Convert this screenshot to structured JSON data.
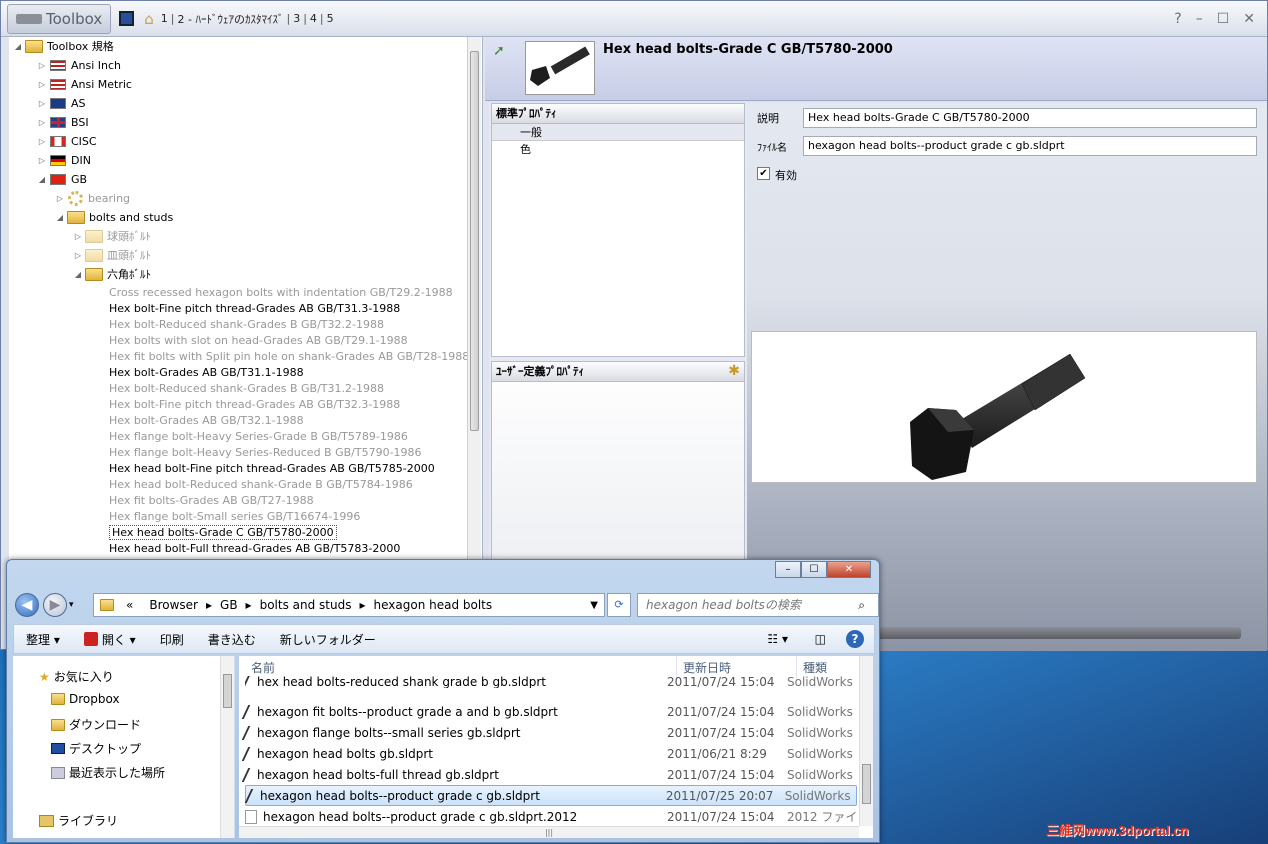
{
  "titlebar": {
    "logo": "Toolbox",
    "tabs": [
      "1",
      "2 - ﾊｰﾄﾞｳｪｱのｶｽﾀﾏｲｽﾞ",
      "3",
      "4",
      "5"
    ],
    "help": "?",
    "minimize": "–",
    "maximize": "☐",
    "close": "✕"
  },
  "tree": {
    "root": "Toolbox 規格",
    "standards": [
      "Ansi Inch",
      "Ansi Metric",
      "AS",
      "BSI",
      "CISC",
      "DIN",
      "GB"
    ],
    "gb_children": [
      "bearing",
      "bolts and studs"
    ],
    "bolt_groups": [
      "球頭ﾎﾞﾙﾄ",
      "皿頭ﾎﾞﾙﾄ",
      "六角ﾎﾞﾙﾄ"
    ],
    "items": [
      {
        "label": "Cross recessed hexagon bolts with indentation GB/T29.2-1988",
        "enabled": false
      },
      {
        "label": "Hex bolt-Fine pitch thread-Grades AB GB/T31.3-1988",
        "enabled": true
      },
      {
        "label": "Hex bolt-Reduced shank-Grades B GB/T32.2-1988",
        "enabled": false
      },
      {
        "label": "Hex bolts with slot on head-Grades AB GB/T29.1-1988",
        "enabled": false
      },
      {
        "label": "Hex fit bolts with Split pin hole on shank-Grades AB GB/T28-1988",
        "enabled": false
      },
      {
        "label": "Hex bolt-Grades AB GB/T31.1-1988",
        "enabled": true
      },
      {
        "label": "Hex bolt-Reduced shank-Grades B GB/T31.2-1988",
        "enabled": false
      },
      {
        "label": "Hex bolt-Fine pitch thread-Grades AB GB/T32.3-1988",
        "enabled": false
      },
      {
        "label": "Hex bolt-Grades AB GB/T32.1-1988",
        "enabled": false
      },
      {
        "label": "Hex flange bolt-Heavy Series-Grade B GB/T5789-1986",
        "enabled": false
      },
      {
        "label": "Hex flange bolt-Heavy Series-Reduced B GB/T5790-1986",
        "enabled": false
      },
      {
        "label": "Hex head bolt-Fine pitch thread-Grades AB GB/T5785-2000",
        "enabled": true
      },
      {
        "label": "Hex head bolt-Reduced shank-Grade B GB/T5784-1986",
        "enabled": false
      },
      {
        "label": "Hex fit bolts-Grades AB GB/T27-1988",
        "enabled": false
      },
      {
        "label": "Hex flange bolt-Small series GB/T16674-1996",
        "enabled": false
      },
      {
        "label": "Hex head bolts-Grade C GB/T5780-2000",
        "enabled": true,
        "selected": true
      },
      {
        "label": "Hex head bolt-Full thread-Grades AB GB/T5783-2000",
        "enabled": true
      }
    ]
  },
  "properties": {
    "title": "Hex head bolts-Grade C GB/T5780-2000",
    "standard_panel": "標準ﾌﾟﾛﾊﾟﾃｨ",
    "standard_items": [
      "一般",
      "色"
    ],
    "user_panel": "ﾕｰｻﾞｰ定義ﾌﾟﾛﾊﾟﾃｨ",
    "desc_label": "説明",
    "desc_value": "Hex head bolts-Grade C GB/T5780-2000",
    "file_label": "ﾌｧｲﾙ名",
    "file_value": "hexagon head bolts--product grade c gb.sldprt",
    "enabled_label": "有効"
  },
  "explorer": {
    "address": [
      "«",
      "Browser",
      "GB",
      "bolts and studs",
      "hexagon head bolts"
    ],
    "search_placeholder": "hexagon head boltsの検索",
    "toolbar": [
      "整理 ▾",
      "開く ▾",
      "印刷",
      "書き込む",
      "新しいフォルダー"
    ],
    "nav": [
      "お気に入り",
      "Dropbox",
      "ダウンロード",
      "デスクトップ",
      "最近表示した場所",
      "ライブラリ"
    ],
    "columns": [
      "名前",
      "更新日時",
      "種類"
    ],
    "files": [
      {
        "name": "hex head bolts-reduced shank grade b gb.sldprt",
        "date": "2011/07/24 15:04",
        "type": "SolidWorks"
      },
      {
        "name": "hexagon fit bolts--product grade a and b gb.sldprt",
        "date": "2011/07/24 15:04",
        "type": "SolidWorks"
      },
      {
        "name": "hexagon flange bolts--small series gb.sldprt",
        "date": "2011/07/24 15:04",
        "type": "SolidWorks"
      },
      {
        "name": "hexagon head bolts gb.sldprt",
        "date": "2011/06/21 8:29",
        "type": "SolidWorks"
      },
      {
        "name": "hexagon head bolts-full thread gb.sldprt",
        "date": "2011/07/24 15:04",
        "type": "SolidWorks"
      },
      {
        "name": "hexagon head bolts--product grade c gb.sldprt",
        "date": "2011/07/25 20:07",
        "type": "SolidWorks",
        "selected": true
      },
      {
        "name": "hexagon head bolts--product grade c gb.sldprt.2012",
        "date": "2011/07/24 15:04",
        "type": "2012 ファイ"
      }
    ]
  },
  "watermark": "三維网www.3dportal.cn"
}
